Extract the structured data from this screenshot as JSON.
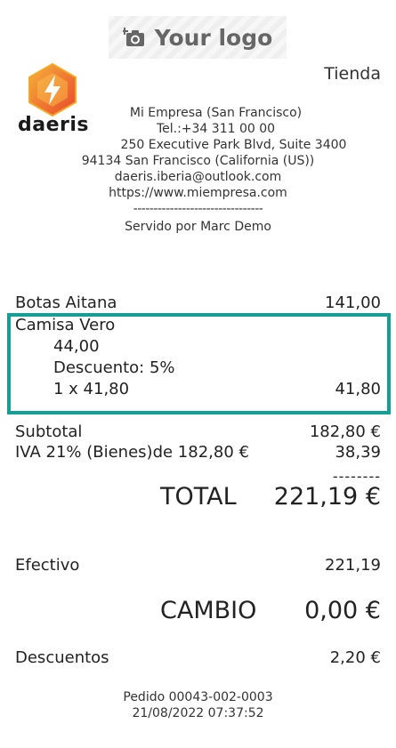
{
  "logo_placeholder": {
    "label": "Your logo",
    "icon": "camera-plus-icon"
  },
  "store_label": "Tienda",
  "brand": {
    "word": "daeris",
    "icon": "lightning-hexagon-icon",
    "colors": {
      "orange": "#f5a623",
      "red": "#e8452c",
      "white": "#ffffff"
    }
  },
  "company": {
    "name": "Mi Empresa (San Francisco)",
    "phone": "Tel.:+34 311 00 00",
    "street": "250 Executive Park Blvd, Suite 3400",
    "city": "94134 San Francisco (California (US))",
    "email": "daeris.iberia@outlook.com",
    "website": "https://www.miempresa.com",
    "separator": "--------------------------------",
    "served_by": "Servido por Marc Demo"
  },
  "lines": [
    {
      "product": "Botas Aitana",
      "amount": "141,00"
    },
    {
      "product": "Camisa Vero",
      "original_price": "44,00",
      "discount": "Descuento: 5%",
      "qty_price": "1 x 41,80",
      "amount": "41,80"
    }
  ],
  "highlight_color": "#159e96",
  "totals": {
    "subtotal_label": "Subtotal",
    "subtotal_value": "182,80 €",
    "tax_label": "IVA 21% (Bienes)de 182,80 €",
    "tax_value": "38,39",
    "dashes": "--------",
    "total_label": "TOTAL",
    "total_value": "221,19 €"
  },
  "payment": {
    "method_label": "Efectivo",
    "method_value": "221,19",
    "change_label": "CAMBIO",
    "change_value": "0,00 €",
    "discounts_label": "Descuentos",
    "discounts_value": "2,20 €"
  },
  "footer": {
    "order": "Pedido 00043-002-0003",
    "datetime": "21/08/2022 07:37:52"
  }
}
